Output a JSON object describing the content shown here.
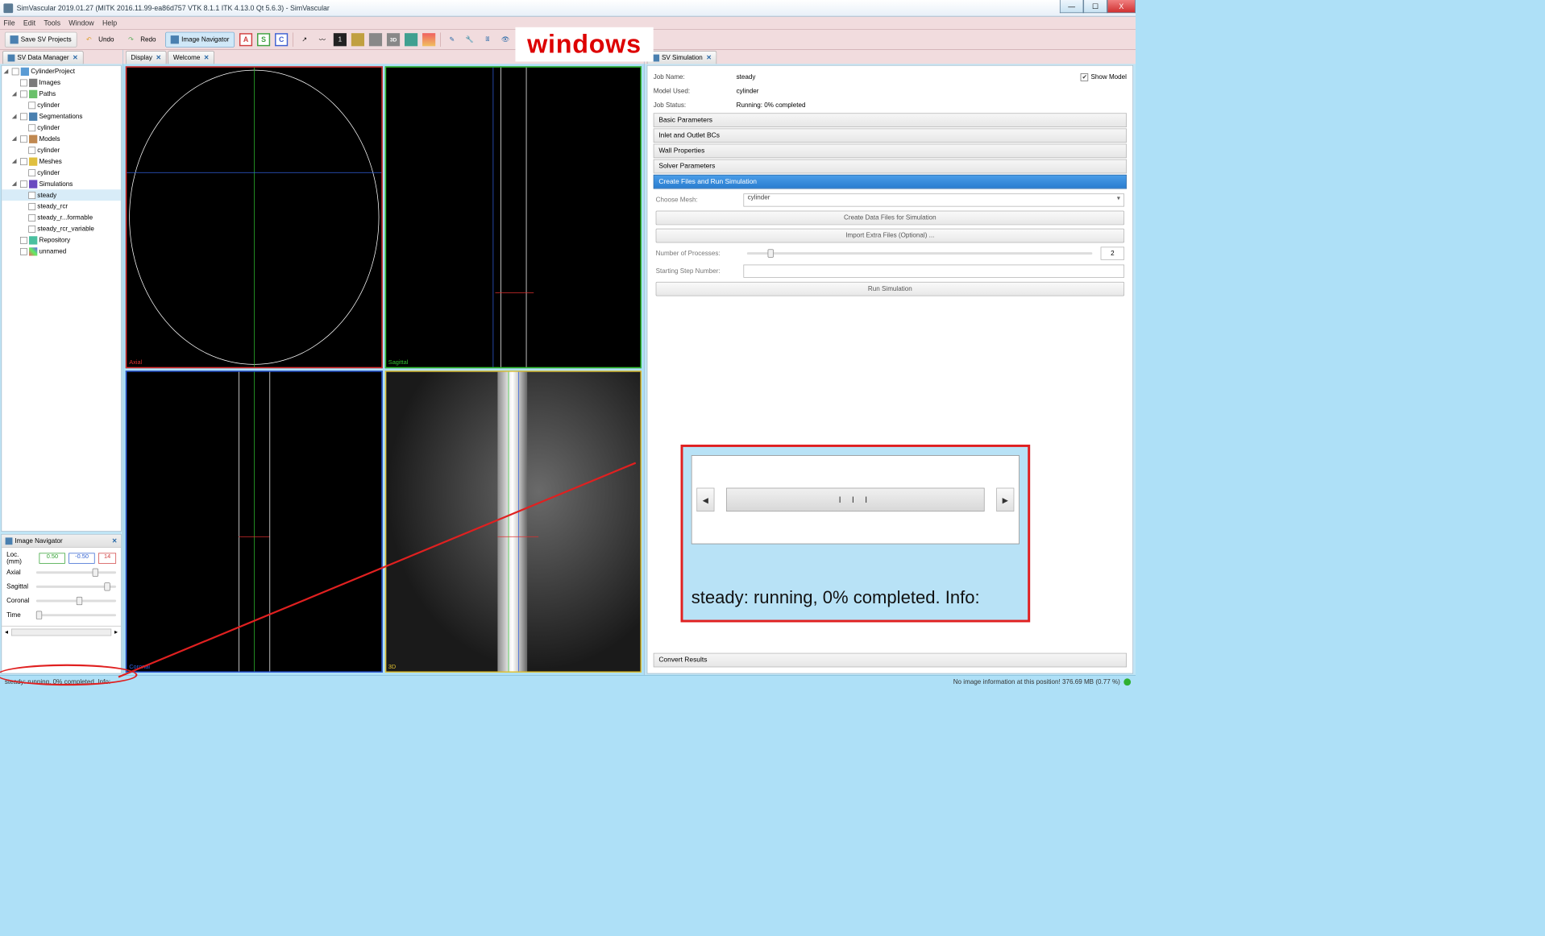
{
  "window": {
    "title": "SimVascular 2019.01.27 (MITK 2016.11.99-ea86d757 VTK 8.1.1 ITK 4.13.0 Qt 5.6.3) - SimVascular",
    "min": "—",
    "max": "☐",
    "close": "X"
  },
  "menu": {
    "file": "File",
    "edit": "Edit",
    "tools": "Tools",
    "window": "Window",
    "help": "Help"
  },
  "toolbar": {
    "save": "Save SV Projects",
    "undo": "Undo",
    "redo": "Redo",
    "imgnav": "Image Navigator",
    "A": "A",
    "S": "S",
    "C": "C"
  },
  "annotation": "windows",
  "left_tab": "SV Data Manager",
  "tree": {
    "root": "CylinderProject",
    "images": "Images",
    "paths": "Paths",
    "paths_c": "cylinder",
    "seg": "Segmentations",
    "seg_c": "cylinder",
    "models": "Models",
    "models_c": "cylinder",
    "meshes": "Meshes",
    "meshes_c": "cylinder",
    "sims": "Simulations",
    "sim1": "steady",
    "sim2": "steady_rcr",
    "sim3": "steady_r...formable",
    "sim4": "steady_rcr_variable",
    "repo": "Repository",
    "unk": "unnamed"
  },
  "imgnav": {
    "title": "Image Navigator",
    "loc": "Loc. (mm)",
    "v1": "0.50",
    "v2": "-0.50",
    "v3": "14",
    "axial": "Axial",
    "sag": "Sagittal",
    "cor": "Coronal",
    "time": "Time"
  },
  "center_tabs": {
    "display": "Display",
    "welcome": "Welcome"
  },
  "views": {
    "axial": "Axial",
    "sag": "Sagittal",
    "cor": "Coronal",
    "td": "3D"
  },
  "right_tab": "SV Simulation",
  "sim": {
    "job_lab": "Job Name:",
    "job": "steady",
    "model_lab": "Model Used:",
    "model": "cylinder",
    "status_lab": "Job Status:",
    "status": "Running: 0% completed",
    "show": "Show Model",
    "acc1": "Basic Parameters",
    "acc2": "Inlet and Outlet BCs",
    "acc3": "Wall Properties",
    "acc4": "Solver Parameters",
    "acc5": "Create Files and Run Simulation",
    "mesh_lab": "Choose Mesh:",
    "mesh": "cylinder",
    "btn1": "Create Data Files for Simulation",
    "btn2": "Import Extra Files (Optional) ...",
    "np_lab": "Number of Processes:",
    "np": "2",
    "ss_lab": "Starting Step Number:",
    "ss": "",
    "run": "Run Simulation",
    "acc6": "Convert Results"
  },
  "callout": {
    "bar": "| | |",
    "msg": "steady: running, 0% completed. Info:"
  },
  "status": {
    "left": "steady: running, 0% completed. Info:",
    "right": "No image information at this position!  376.69 MB (0.77 %)"
  }
}
